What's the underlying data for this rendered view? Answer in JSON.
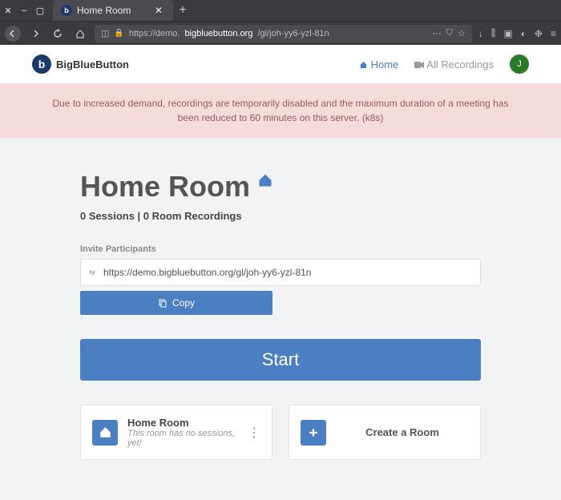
{
  "browser": {
    "tab_title": "Home Room",
    "url_display_prefix": "https://demo.",
    "url_display_domain": "bigbluebutton.org",
    "url_display_suffix": "/gl/joh-yy6-yzl-81n"
  },
  "nav": {
    "brand": "BigBlueButton",
    "home_label": "Home",
    "recordings_label": "All Recordings",
    "avatar_initial": "J"
  },
  "alert": {
    "text": "Due to increased demand, recordings are temporarily disabled and the maximum duration of a meeting has been reduced to 60 minutes on this server. (k8s)"
  },
  "room": {
    "title": "Home Room",
    "stats": "0 Sessions | 0 Room Recordings",
    "invite_label": "Invite Participants",
    "invite_url": "https://demo.bigbluebutton.org/gl/joh-yy6-yzl-81n",
    "copy_label": "Copy",
    "start_label": "Start"
  },
  "cards": {
    "home_title": "Home Room",
    "home_subtitle": "This room has no sessions, yet!",
    "create_label": "Create a Room"
  }
}
